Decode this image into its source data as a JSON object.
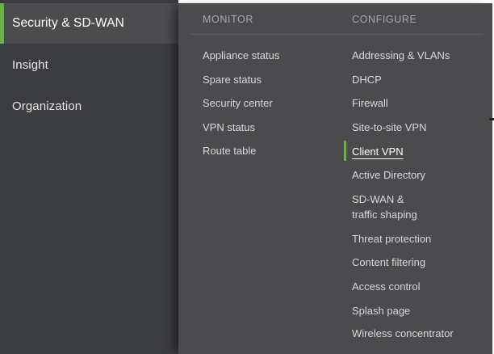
{
  "sidebar": {
    "items": [
      {
        "label": "Security & SD-WAN",
        "active": true
      },
      {
        "label": "Insight",
        "active": false
      },
      {
        "label": "Organization",
        "active": false
      }
    ]
  },
  "flyout": {
    "monitor": {
      "heading": "MONITOR",
      "items": [
        "Appliance status",
        "Spare status",
        "Security center",
        "VPN status",
        "Route table"
      ]
    },
    "configure": {
      "heading": "CONFIGURE",
      "items": [
        "Addressing & VLANs",
        "DHCP",
        "Firewall",
        "Site-to-site VPN",
        "Client VPN",
        "Active Directory",
        "SD-WAN &",
        "traffic shaping",
        "Threat protection",
        "Content filtering",
        "Access control",
        "Splash page",
        "Wireless concentrator"
      ],
      "selected": "Client VPN"
    }
  },
  "colors": {
    "sidebar_bg": "#3b3c3f",
    "sidebar_active_bg": "#4c4c4f",
    "flyout_bg": "#4b4b4e",
    "accent_green": "#67b346"
  }
}
